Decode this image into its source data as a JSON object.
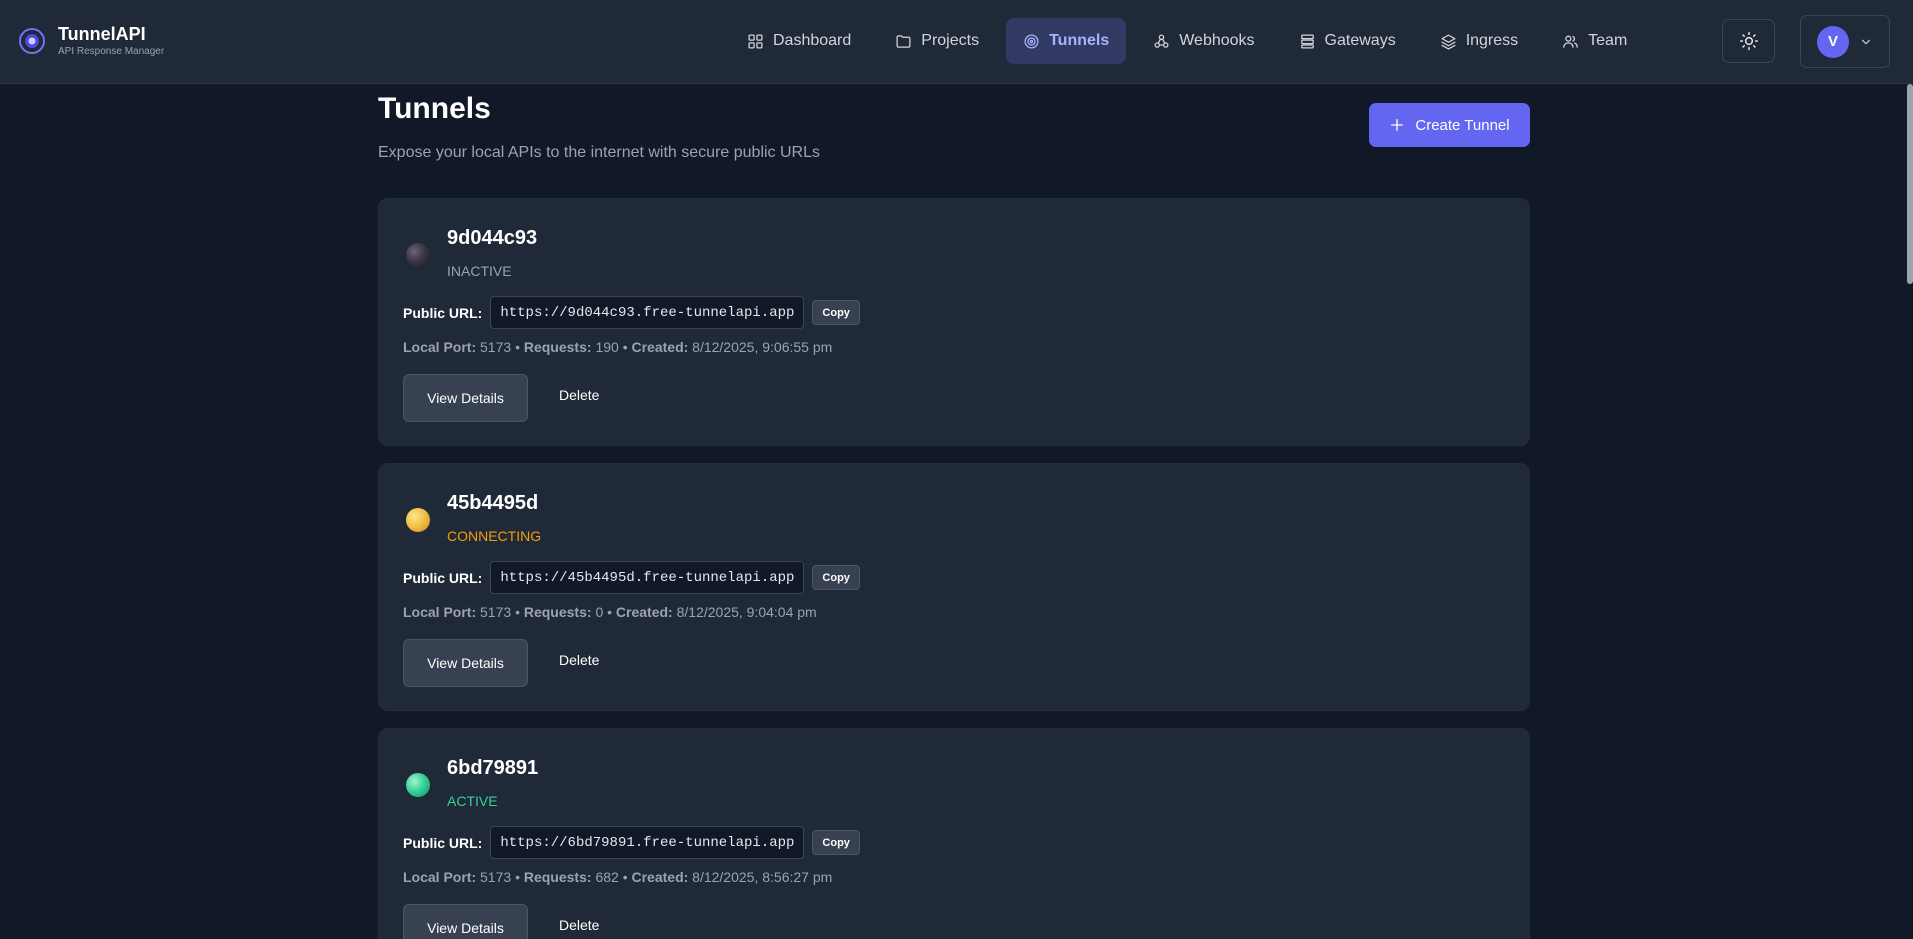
{
  "brand": {
    "name": "TunnelAPI",
    "tagline": "API Response Manager"
  },
  "nav": [
    {
      "label": "Dashboard",
      "icon": "grid-icon"
    },
    {
      "label": "Projects",
      "icon": "folder-icon"
    },
    {
      "label": "Tunnels",
      "icon": "target-icon",
      "active": true
    },
    {
      "label": "Webhooks",
      "icon": "webhook-icon"
    },
    {
      "label": "Gateways",
      "icon": "server-icon"
    },
    {
      "label": "Ingress",
      "icon": "layers-icon"
    },
    {
      "label": "Team",
      "icon": "users-icon"
    }
  ],
  "user": {
    "initial": "V"
  },
  "page": {
    "title": "Tunnels",
    "subtitle": "Expose your local APIs to the internet with secure public URLs",
    "create_label": "Create Tunnel"
  },
  "labels": {
    "public_url": "Public URL:",
    "copy": "Copy",
    "local_port": "Local Port:",
    "requests": "Requests:",
    "created": "Created:",
    "separator": "•",
    "view_details": "View Details",
    "delete": "Delete"
  },
  "tunnels": [
    {
      "id": "9d044c93",
      "status": "INACTIVE",
      "url": "https://9d044c93.free-tunnelapi.app",
      "port": "5173",
      "requests": "190",
      "created": "8/12/2025, 9:06:55 pm"
    },
    {
      "id": "45b4495d",
      "status": "CONNECTING",
      "url": "https://45b4495d.free-tunnelapi.app",
      "port": "5173",
      "requests": "0",
      "created": "8/12/2025, 9:04:04 pm"
    },
    {
      "id": "6bd79891",
      "status": "ACTIVE",
      "url": "https://6bd79891.free-tunnelapi.app",
      "port": "5173",
      "requests": "682",
      "created": "8/12/2025, 8:56:27 pm"
    }
  ],
  "colors": {
    "accent": "#6366f1",
    "active": "#34d399",
    "connecting": "#f59e0b",
    "inactive": "#9ca3af"
  }
}
